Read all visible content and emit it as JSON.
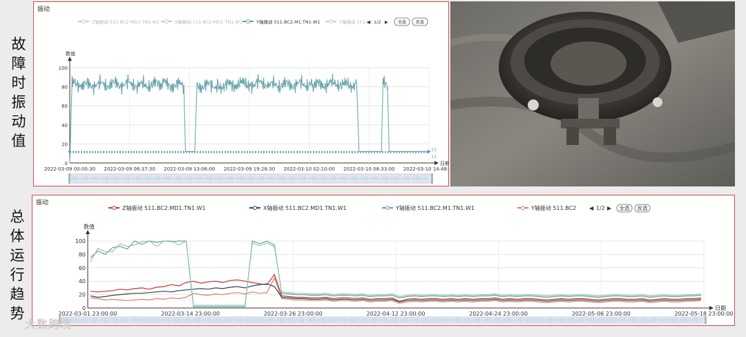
{
  "side_labels": {
    "top": [
      "故",
      "障",
      "时",
      "振",
      "动",
      "值"
    ],
    "bottom": [
      "总",
      "体",
      "运",
      "行",
      "趋",
      "势"
    ]
  },
  "watermark": "大数跨境",
  "colors": {
    "z_series": "#c23531",
    "x_series": "#2f4554",
    "y_series": "#61a0a8",
    "y2_series": "#d48265",
    "z_series_top": "#c9c9c9",
    "x_series_top": "#c9c9c9",
    "y2_series_top": "#c9c9c9",
    "y_series_top": "#61a0a8",
    "border": "#d04a4a"
  },
  "photo": {
    "icon": "photo-gearbox-hub-image"
  },
  "top_chart": {
    "panel_title": "振动",
    "legend": [
      {
        "label": "Z轴振动 511.BC2.MD1.TN1.W1",
        "color_key": "z_series_top"
      },
      {
        "label": "X轴振动 511.BC2.MD1.TN1.W1",
        "color_key": "x_series_top"
      },
      {
        "label": "Y轴振动 511.BC2.M1.TN1.W1",
        "color_key": "y_series_top"
      },
      {
        "label": "Y轴振动 511.BC",
        "color_key": "y2_series_top"
      }
    ],
    "pager": "1/2",
    "btn_all": "全选",
    "btn_invert": "反选",
    "ylabel": "数值",
    "xlabel": "日期",
    "y_ticks": [
      "0",
      "20",
      "40",
      "60",
      "80",
      "100"
    ],
    "x_ticks": [
      "2022-03-09 00:00:30",
      "2022-03-09 06:37:30",
      "2022-03-09 13:06:00",
      "2022-03-09 19:28:30",
      "2022-03-10 02:10:00",
      "2022-03-10 08:33:00",
      "2022-03-10 14:48:00"
    ],
    "markline_labels": [
      "12",
      "11"
    ]
  },
  "bottom_chart": {
    "panel_title": "振动",
    "legend": [
      {
        "label": "Z轴振动 511.BC2.MD1.TN1.W1",
        "color_key": "z_series"
      },
      {
        "label": "X轴振动 511.BC2.MD1.TN1.W1",
        "color_key": "x_series"
      },
      {
        "label": "Y轴振动 511.BC2.M1.TN1.W1",
        "color_key": "y_series"
      },
      {
        "label": "Y轴振动 511.BC2",
        "color_key": "y2_series"
      }
    ],
    "pager": "1/2",
    "btn_all": "全选",
    "btn_invert": "反选",
    "ylabel": "数值",
    "xlabel": "日期",
    "y_ticks": [
      "0",
      "20",
      "40",
      "60",
      "80",
      "100"
    ],
    "x_ticks": [
      "2022-03-01 23:00:00",
      "2022-03-14 23:00:00",
      "2022-03-26 23:00:00",
      "2022-04-12 23:00:00",
      "2022-04-24 23:00:00",
      "2022-05-06 23:00:00",
      "2022-05-18 23:00:00"
    ]
  },
  "chart_data": [
    {
      "type": "line",
      "title": "振动",
      "xlabel": "日期",
      "ylabel": "数值",
      "ylim": [
        0,
        100
      ],
      "x_range": [
        "2022-03-09 00:00:30",
        "2022-03-10 14:48:00"
      ],
      "series": [
        {
          "name": "Y轴振动 511.BC2.M1.TN1.W1",
          "points": [
            {
              "x": "2022-03-09 00:00:30",
              "y": 0
            },
            {
              "x": "2022-03-09 00:15:00",
              "y": 82
            },
            {
              "x": "2022-03-09 03:00:00",
              "y": 83
            },
            {
              "x": "2022-03-09 06:37:30",
              "y": 82
            },
            {
              "x": "2022-03-09 10:00:00",
              "y": 83
            },
            {
              "x": "2022-03-09 12:20:00",
              "y": 82
            },
            {
              "x": "2022-03-09 12:30:00",
              "y": 12
            },
            {
              "x": "2022-03-09 13:30:00",
              "y": 12
            },
            {
              "x": "2022-03-09 13:45:00",
              "y": 82
            },
            {
              "x": "2022-03-09 16:00:00",
              "y": 82
            },
            {
              "x": "2022-03-09 19:28:30",
              "y": 83
            },
            {
              "x": "2022-03-10 02:10:00",
              "y": 82
            },
            {
              "x": "2022-03-10 07:00:00",
              "y": 83
            },
            {
              "x": "2022-03-10 07:15:00",
              "y": 12
            },
            {
              "x": "2022-03-10 09:40:00",
              "y": 12
            },
            {
              "x": "2022-03-10 09:50:00",
              "y": 82
            },
            {
              "x": "2022-03-10 10:20:00",
              "y": 80
            },
            {
              "x": "2022-03-10 10:30:00",
              "y": 12
            },
            {
              "x": "2022-03-10 14:48:00",
              "y": 12
            }
          ]
        }
      ],
      "marklines": [
        12,
        11
      ]
    },
    {
      "type": "line",
      "title": "振动",
      "xlabel": "日期",
      "ylabel": "数值",
      "ylim": [
        0,
        100
      ],
      "x": [
        "2022-03-01",
        "2022-03-02",
        "2022-03-03",
        "2022-03-04",
        "2022-03-05",
        "2022-03-06",
        "2022-03-07",
        "2022-03-08",
        "2022-03-09",
        "2022-03-10",
        "2022-03-11",
        "2022-03-12",
        "2022-03-13",
        "2022-03-14",
        "2022-03-15",
        "2022-03-16",
        "2022-03-17",
        "2022-03-18",
        "2022-03-19",
        "2022-03-20",
        "2022-03-21",
        "2022-03-22",
        "2022-03-23",
        "2022-03-24",
        "2022-03-25",
        "2022-03-26",
        "2022-03-27",
        "2022-03-28",
        "2022-03-29",
        "2022-03-30",
        "2022-03-31",
        "2022-04-01",
        "2022-04-02",
        "2022-04-03",
        "2022-04-04",
        "2022-04-05",
        "2022-04-06",
        "2022-04-07",
        "2022-04-08",
        "2022-04-09",
        "2022-04-10",
        "2022-04-11",
        "2022-04-12",
        "2022-04-13",
        "2022-04-14",
        "2022-04-15",
        "2022-04-16",
        "2022-04-17",
        "2022-04-18",
        "2022-04-19",
        "2022-04-20",
        "2022-04-21",
        "2022-04-22",
        "2022-04-23",
        "2022-04-24",
        "2022-04-25",
        "2022-04-26",
        "2022-04-27",
        "2022-04-28",
        "2022-04-29",
        "2022-04-30",
        "2022-05-01",
        "2022-05-02",
        "2022-05-03",
        "2022-05-04",
        "2022-05-05",
        "2022-05-06",
        "2022-05-07",
        "2022-05-08",
        "2022-05-09",
        "2022-05-10",
        "2022-05-11",
        "2022-05-12",
        "2022-05-13",
        "2022-05-14",
        "2022-05-15",
        "2022-05-16",
        "2022-05-17",
        "2022-05-18",
        "2022-05-19",
        "2022-05-20",
        "2022-05-21",
        "2022-05-22",
        "2022-05-23"
      ],
      "series": [
        {
          "name": "Z轴振动 511.BC2.MD1.TN1.W1",
          "values": [
            25,
            24,
            25,
            26,
            28,
            27,
            29,
            30,
            28,
            31,
            32,
            35,
            33,
            38,
            40,
            37,
            39,
            40,
            38,
            41,
            42,
            40,
            38,
            36,
            35,
            50,
            18,
            17,
            16,
            16,
            15,
            15,
            16,
            14,
            15,
            15,
            14,
            15,
            13,
            14,
            14,
            15,
            10,
            13,
            14,
            13,
            14,
            14,
            13,
            14,
            13,
            14,
            13,
            14,
            14,
            15,
            13,
            14,
            13,
            14,
            14,
            13,
            12,
            13,
            14,
            13,
            14,
            14,
            13,
            12,
            13,
            14,
            14,
            13,
            13,
            14,
            12,
            13,
            14,
            13,
            13,
            14,
            14,
            15
          ]
        },
        {
          "name": "X轴振动 511.BC2.MD1.TN1.W1",
          "values": [
            18,
            16,
            17,
            19,
            20,
            21,
            22,
            22,
            23,
            24,
            25,
            24,
            26,
            27,
            28,
            29,
            28,
            30,
            29,
            31,
            32,
            30,
            33,
            35,
            36,
            32,
            16,
            15,
            14,
            14,
            13,
            13,
            14,
            12,
            13,
            13,
            12,
            13,
            11,
            12,
            12,
            13,
            9,
            11,
            12,
            11,
            12,
            12,
            11,
            12,
            11,
            12,
            11,
            12,
            12,
            13,
            11,
            12,
            11,
            12,
            12,
            11,
            10,
            11,
            12,
            11,
            12,
            12,
            11,
            10,
            11,
            12,
            12,
            11,
            11,
            12,
            10,
            11,
            12,
            11,
            11,
            12,
            12,
            13
          ]
        },
        {
          "name": "Y轴振动 511.BC2.M1.TN1.W1",
          "values": [
            75,
            85,
            80,
            90,
            92,
            88,
            100,
            95,
            100,
            98,
            100,
            99,
            100,
            100,
            2,
            2,
            2,
            2,
            2,
            2,
            2,
            2,
            100,
            96,
            100,
            94,
            22,
            21,
            20,
            20,
            19,
            19,
            20,
            18,
            19,
            19,
            18,
            19,
            17,
            18,
            18,
            19,
            15,
            17,
            18,
            17,
            18,
            18,
            17,
            18,
            17,
            18,
            17,
            18,
            18,
            19,
            17,
            18,
            17,
            18,
            18,
            17,
            16,
            17,
            18,
            17,
            18,
            18,
            17,
            16,
            17,
            18,
            18,
            17,
            17,
            18,
            16,
            17,
            18,
            17,
            17,
            18,
            18,
            19
          ]
        },
        {
          "name": "Y轴振动 511.BC2",
          "values": [
            15,
            14,
            12,
            13,
            12,
            11,
            12,
            13,
            12,
            14,
            13,
            15,
            14,
            16,
            22,
            20,
            19,
            21,
            20,
            22,
            23,
            21,
            24,
            22,
            23,
            45,
            14,
            13,
            12,
            12,
            11,
            11,
            12,
            10,
            11,
            11,
            10,
            11,
            9,
            10,
            10,
            11,
            7,
            9,
            10,
            9,
            10,
            10,
            9,
            10,
            9,
            10,
            9,
            10,
            10,
            11,
            9,
            10,
            9,
            10,
            10,
            9,
            8,
            9,
            10,
            9,
            10,
            10,
            9,
            8,
            9,
            10,
            10,
            9,
            9,
            10,
            8,
            9,
            10,
            9,
            9,
            10,
            10,
            11
          ]
        }
      ]
    }
  ]
}
